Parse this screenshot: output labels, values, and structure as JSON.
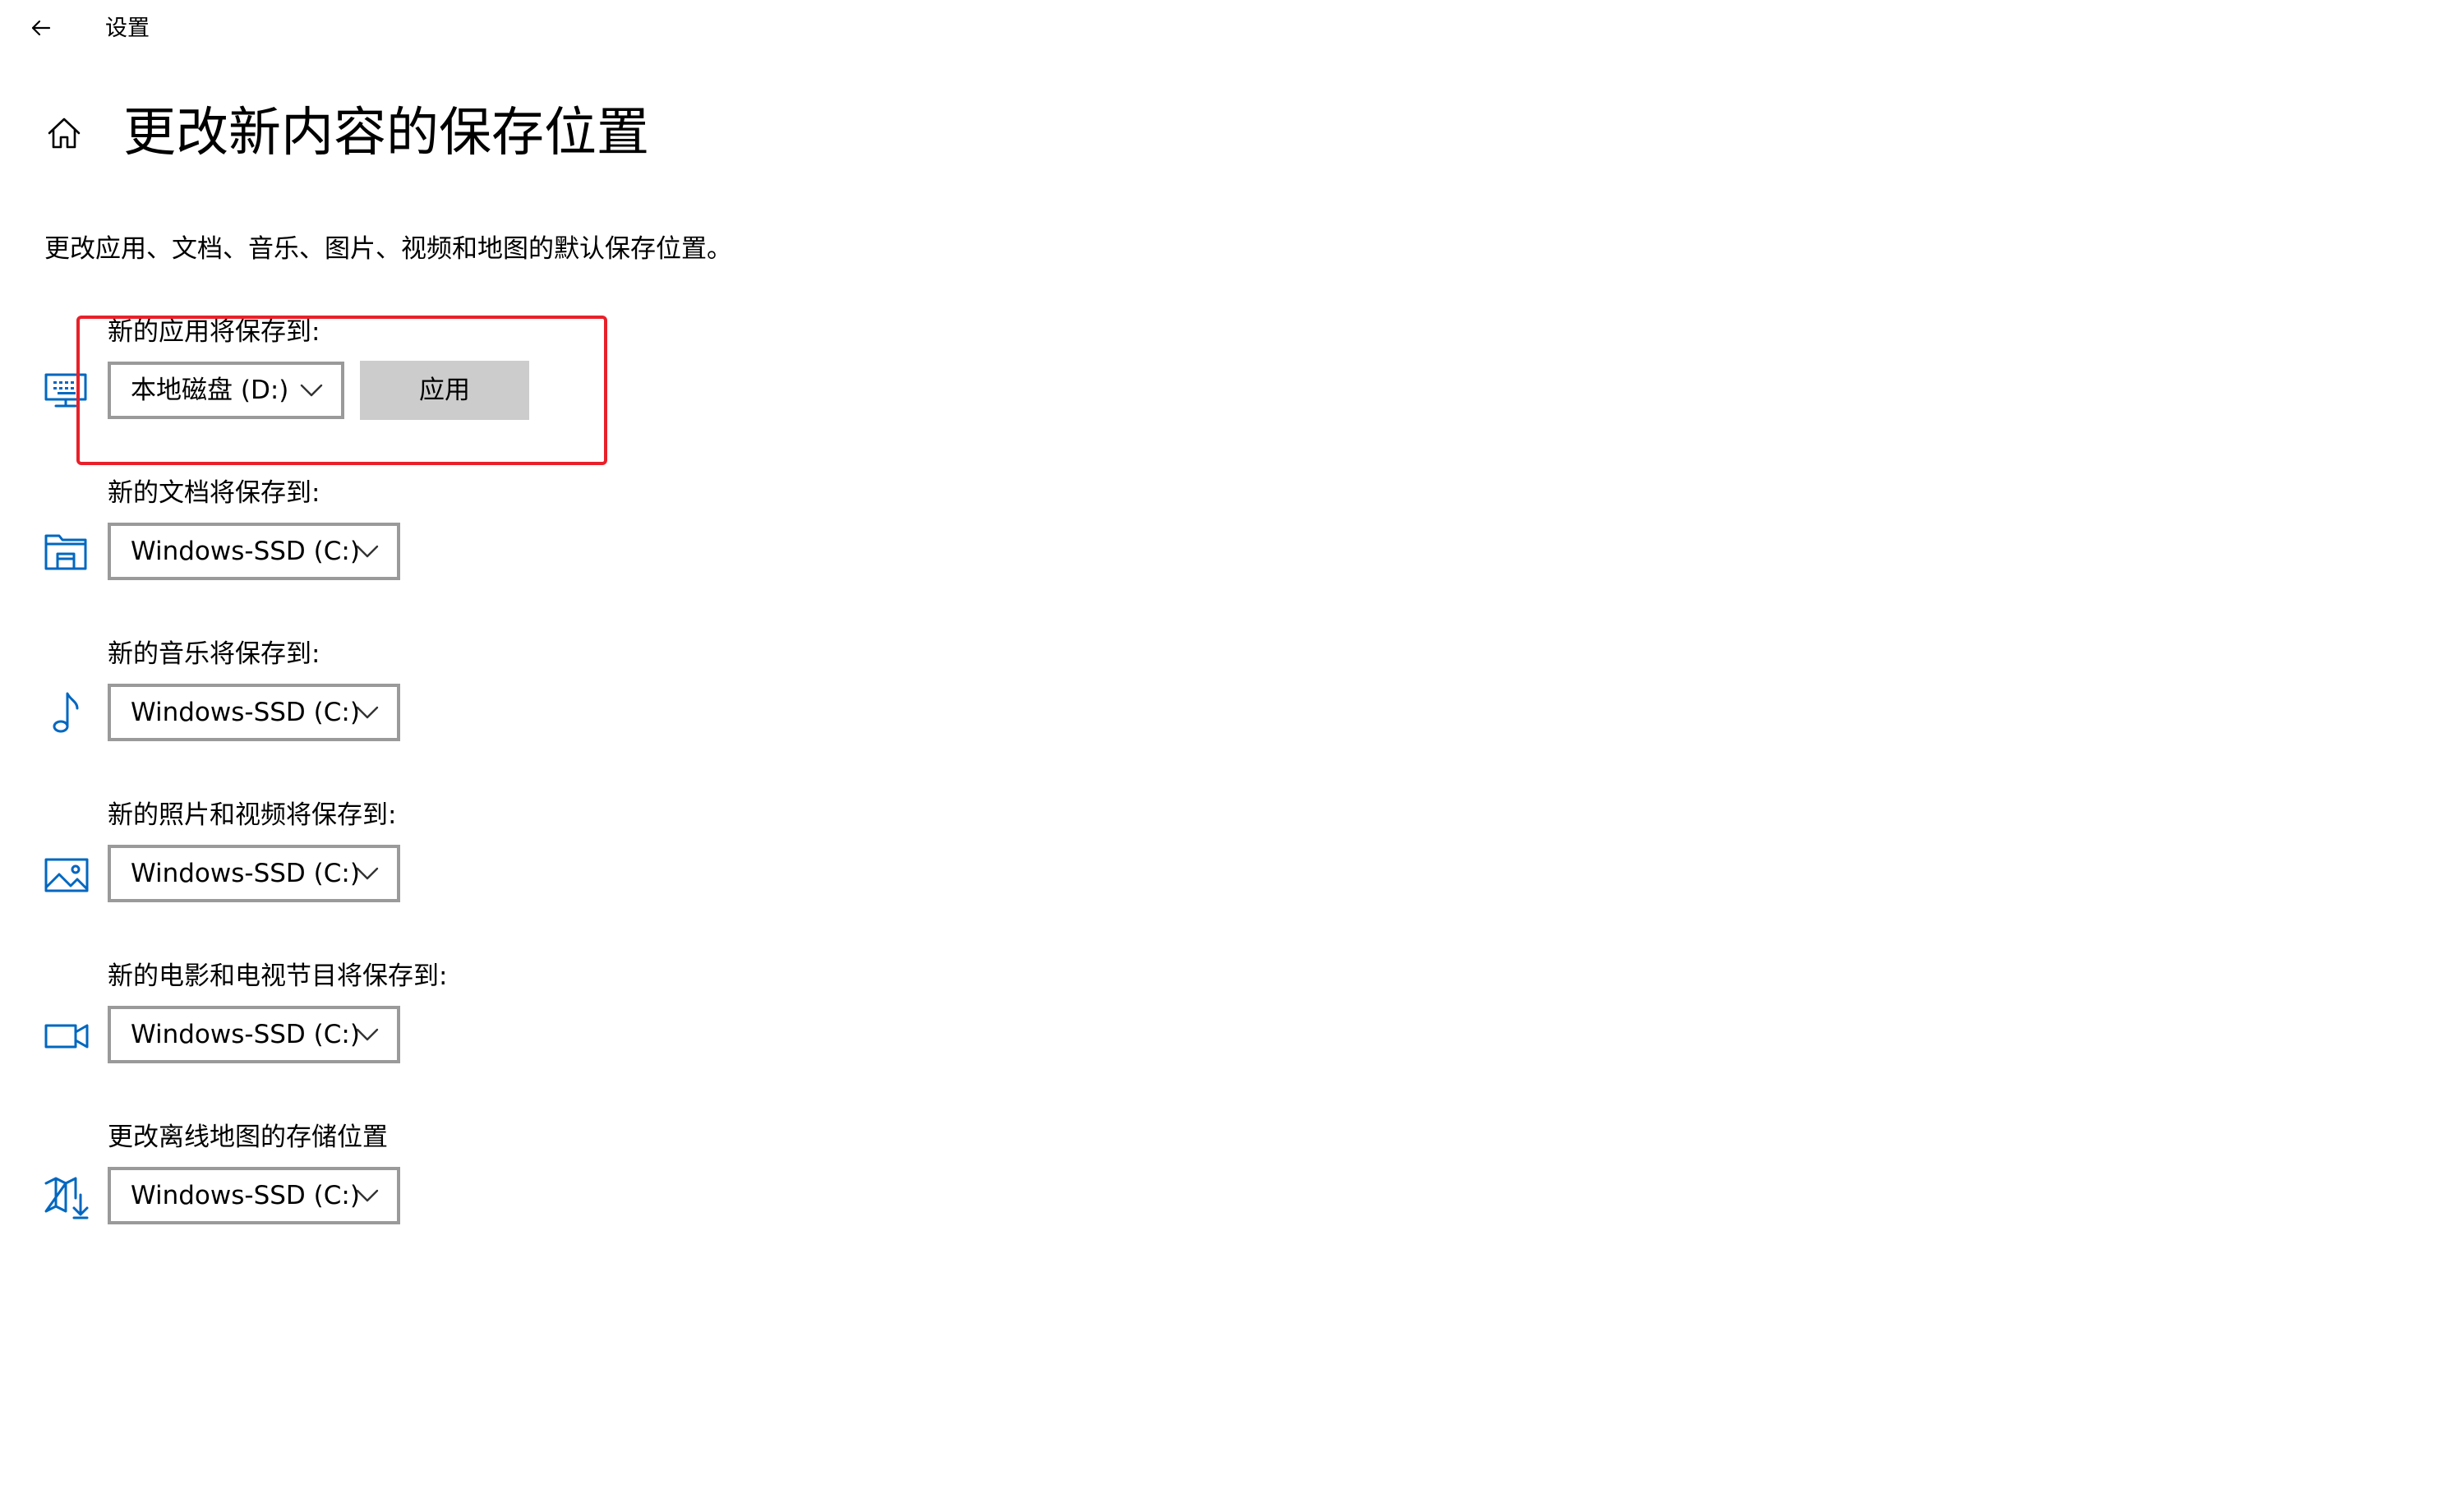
{
  "window": {
    "title": "设置"
  },
  "page": {
    "title": "更改新内容的保存位置",
    "description": "更改应用、文档、音乐、图片、视频和地图的默认保存位置。"
  },
  "sections": {
    "apps": {
      "label": "新的应用将保存到:",
      "selected": "本地磁盘 (D:)",
      "icon": "monitor-keyboard-icon",
      "apply_label": "应用"
    },
    "documents": {
      "label": "新的文档将保存到:",
      "selected": "Windows-SSD (C:)",
      "icon": "document-folder-icon"
    },
    "music": {
      "label": "新的音乐将保存到:",
      "selected": "Windows-SSD (C:)",
      "icon": "music-note-icon"
    },
    "photos": {
      "label": "新的照片和视频将保存到:",
      "selected": "Windows-SSD (C:)",
      "icon": "picture-icon"
    },
    "movies": {
      "label": "新的电影和电视节目将保存到:",
      "selected": "Windows-SSD (C:)",
      "icon": "video-camera-icon"
    },
    "maps": {
      "label": "更改离线地图的存储位置",
      "selected": "Windows-SSD (C:)",
      "icon": "map-download-icon"
    }
  },
  "colors": {
    "accent": "#0067c0",
    "highlight": "#e8202a",
    "button_bg": "#cccccc",
    "dropdown_border": "#9a9a9a"
  }
}
